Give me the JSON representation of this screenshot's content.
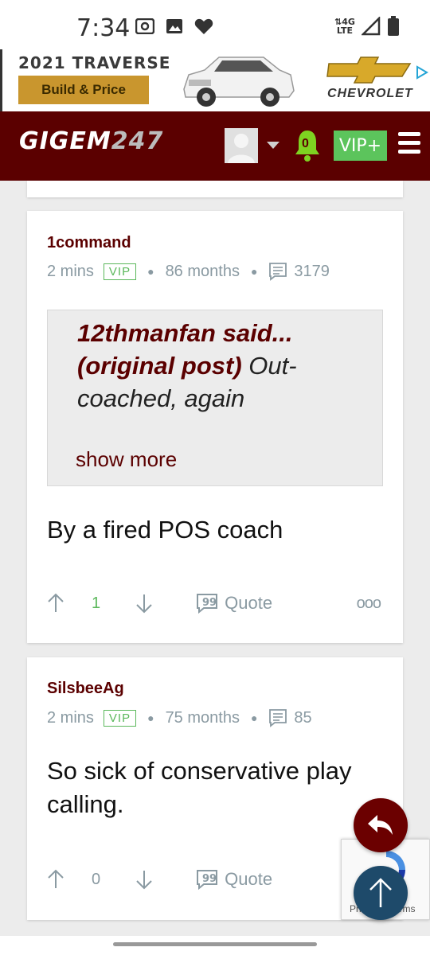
{
  "status_bar": {
    "time": "7:34",
    "network": "4G LTE"
  },
  "ad": {
    "title": "2021 TRAVERSE",
    "button_label": "Build & Price",
    "brand": "CHEVROLET"
  },
  "header": {
    "logo_text": "GIGEM",
    "logo_number": "247",
    "notification_count": "0",
    "vip_label": "VIP+"
  },
  "posts": [
    {
      "author": "1command",
      "time": "2 mins",
      "badge": "VIP",
      "membership": "86 months",
      "post_count": "3179",
      "quote": {
        "author_said": "12thmanfan said...",
        "original_tag": "(original post)",
        "text": " Out-coached, again",
        "show_more": "show more"
      },
      "body": "By a fired POS coach",
      "votes": "1",
      "quote_label": "Quote",
      "more": "ooo"
    },
    {
      "author": "SilsbeeAg",
      "time": "2 mins",
      "badge": "VIP",
      "membership": "75 months",
      "post_count": "85",
      "body": "So sick of conservative play calling.",
      "votes": "0",
      "quote_label": "Quote"
    }
  ],
  "recaptcha": {
    "text": "Privacy - Terms"
  },
  "colors": {
    "maroon": "#5b0000",
    "green": "#5cb85c",
    "meta": "#8a9aa2"
  }
}
